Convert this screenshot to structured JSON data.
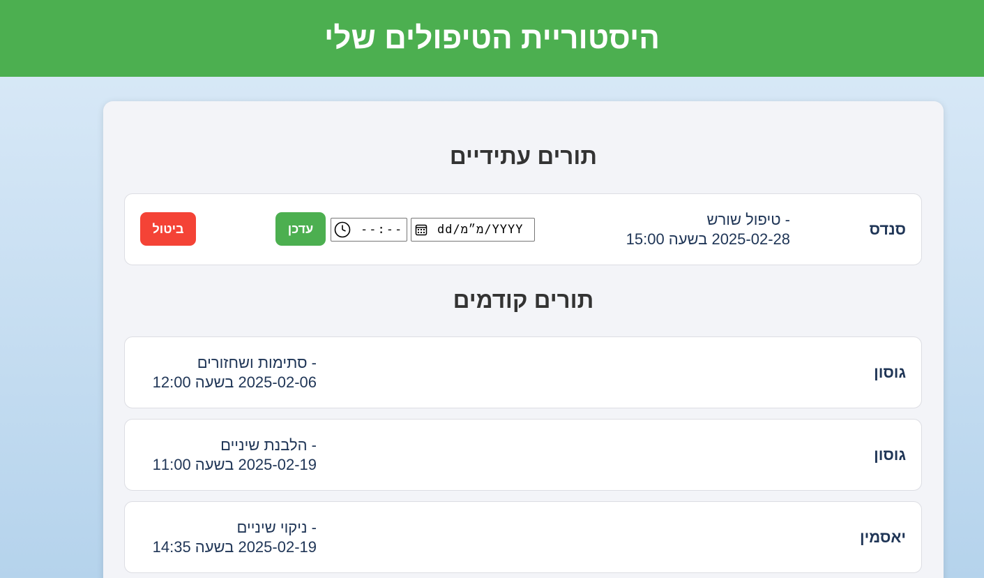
{
  "header": {
    "title": "היסטוריית הטיפולים שלי"
  },
  "upcoming": {
    "title": "תורים עתידיים",
    "items": [
      {
        "doctor": "סנדס",
        "treatment": "- טיפול שורש",
        "datetime": "2025-02-28 בשעה 15:00",
        "date_placeholder": "dd/מ״מ/YYYY",
        "time_placeholder": "--:--",
        "update_label": "עדכן",
        "cancel_label": "ביטול"
      }
    ]
  },
  "past": {
    "title": "תורים קודמים",
    "items": [
      {
        "doctor": "גוסון",
        "treatment": "- סתימות ושחזורים",
        "datetime": "2025-02-06 בשעה 12:00"
      },
      {
        "doctor": "גוסון",
        "treatment": "- הלבנת שיניים",
        "datetime": "2025-02-19 בשעה 11:00"
      },
      {
        "doctor": "יאסמין",
        "treatment": "- ניקוי שיניים",
        "datetime": "2025-02-19 בשעה 14:35"
      }
    ]
  },
  "colors": {
    "header_bg": "#4caf50",
    "update_button": "#4caf50",
    "cancel_button": "#f44336",
    "text_primary": "#1f3556"
  },
  "icons": {
    "date": "calendar-icon",
    "time": "clock-icon"
  }
}
